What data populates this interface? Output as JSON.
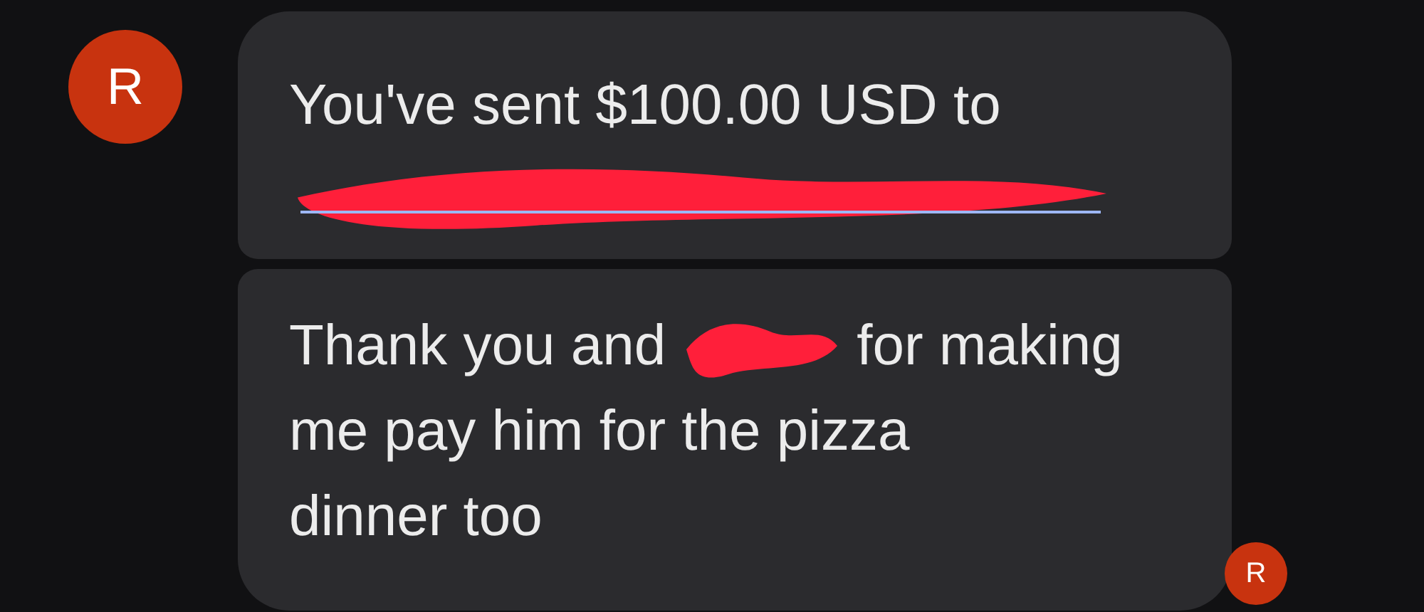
{
  "messages": [
    {
      "avatar": {
        "initial": "R"
      },
      "lines": [
        [
          {
            "kind": "text",
            "text": "You've sent $100.00 USD to"
          }
        ],
        [
          {
            "kind": "redacted-link"
          }
        ]
      ]
    },
    {
      "lines": [
        [
          {
            "kind": "text",
            "text": "Thank you and"
          },
          {
            "kind": "redaction"
          },
          {
            "kind": "text",
            "text": "for making"
          }
        ],
        [
          {
            "kind": "text",
            "text": "me pay him for the pizza"
          }
        ],
        [
          {
            "kind": "text",
            "text": "dinner too"
          }
        ]
      ]
    }
  ],
  "read_receipt": {
    "initial": "R"
  }
}
